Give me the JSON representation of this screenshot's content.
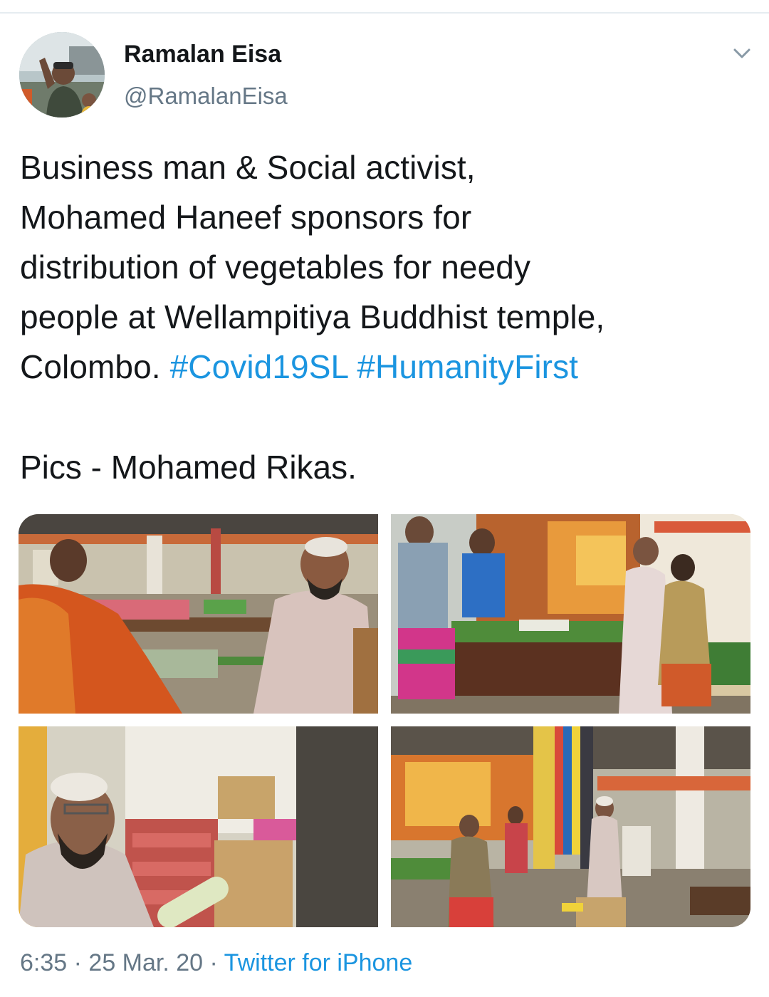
{
  "user": {
    "display_name": "Ramalan Eisa",
    "handle": "@RamalanEisa"
  },
  "tweet": {
    "lines": [
      [
        {
          "text": "Business man & Social activist,",
          "type": "text"
        }
      ],
      [
        {
          "text": "Mohamed Haneef sponsors for",
          "type": "text"
        }
      ],
      [
        {
          "text": "distribution of vegetables for needy",
          "type": "text"
        }
      ],
      [
        {
          "text": "people at Wellampitiya Buddhist temple,",
          "type": "text"
        }
      ],
      [
        {
          "text": "Colombo. ",
          "type": "text"
        },
        {
          "text": "#Covid19SL",
          "type": "hashtag"
        },
        {
          "text": " ",
          "type": "text"
        },
        {
          "text": "#HumanityFirst",
          "type": "hashtag"
        }
      ]
    ],
    "credit": "Pics - Mohamed Rikas."
  },
  "meta": {
    "time": "6:35",
    "sep1": " · ",
    "date": "25 Mar. 20",
    "sep2": " · ",
    "source": "Twitter for iPhone"
  },
  "colors": {
    "link": "#1b95e0",
    "secondary_text": "#657786",
    "primary_text": "#14171a",
    "divider": "#e6ecf0"
  },
  "icons": {
    "chevron": "chevron-down-icon"
  }
}
